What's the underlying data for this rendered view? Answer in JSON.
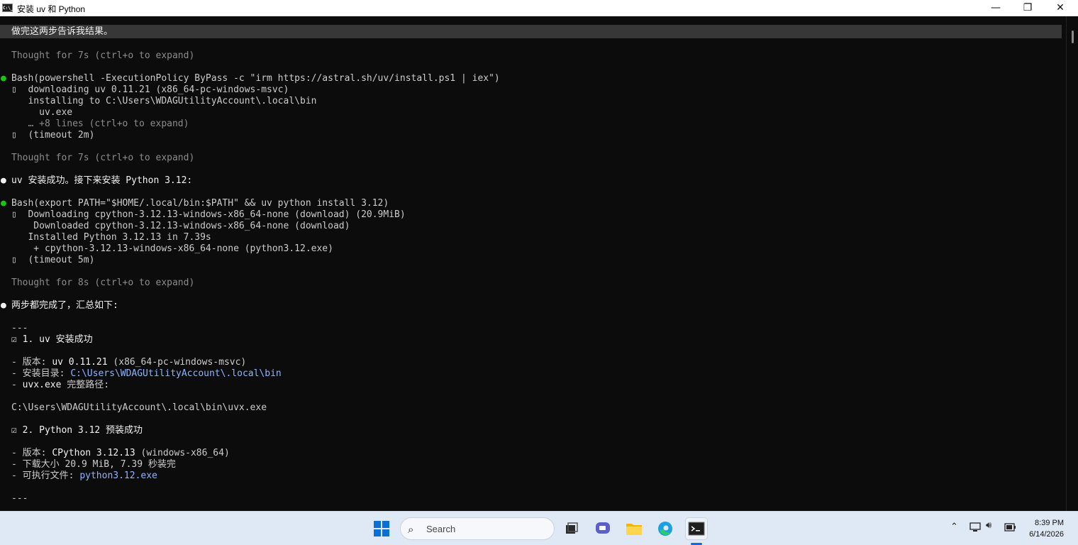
{
  "window": {
    "icon_text": "C:\\_",
    "title": "安装 uv 和 Python",
    "minimize": "—",
    "maximize": "❐",
    "close": "✕"
  },
  "terminal": {
    "input_line": "做完这两步告诉我结果。",
    "lines": {
      "l1": "Thought for 7s (ctrl+o to expand)",
      "l2": "Bash(powershell -ExecutionPolicy ByPass -c \"irm https://astral.sh/uv/install.ps1 | iex\")",
      "l3": "▯  downloading uv 0.11.21 (x86_64-pc-windows-msvc)",
      "l4": "   installing to C:\\Users\\WDAGUtilityAccount\\.local\\bin",
      "l5": "     uv.exe",
      "l6": "   … +8 lines (ctrl+o to expand)",
      "l7": "▯  (timeout 2m)",
      "l8": "Thought for 7s (ctrl+o to expand)",
      "l9": "uv 安装成功。接下来安装 Python 3.12:",
      "l10": "Bash(export PATH=\"$HOME/.local/bin:$PATH\" && uv python install 3.12)",
      "l11": "▯  Downloading cpython-3.12.13-windows-x86_64-none (download) (20.9MiB)",
      "l12": "    Downloaded cpython-3.12.13-windows-x86_64-none (download)",
      "l13": "   Installed Python 3.12.13 in 7.39s",
      "l14": "    + cpython-3.12.13-windows-x86_64-none (python3.12.exe)",
      "l15": "▯  (timeout 5m)",
      "l16": "Thought for 8s (ctrl+o to expand)",
      "l17": "两步都完成了，汇总如下:",
      "l18": "---",
      "l19": "☑ 1. uv 安装成功",
      "l20a": "- 版本: ",
      "l20b": "uv 0.11.21",
      "l20c": " (x86_64-pc-windows-msvc)",
      "l21a": "- 安装目录: ",
      "l21b": "C:\\Users\\WDAGUtilityAccount\\.local\\bin",
      "l22a": "- ",
      "l22b": "uvx.exe",
      "l22c": " 完整路径:",
      "l23": "C:\\Users\\WDAGUtilityAccount\\.local\\bin\\uvx.exe",
      "l24": "☑ 2. Python 3.12 预装成功",
      "l25a": "- 版本: ",
      "l25b": "CPython 3.12.13",
      "l25c": " (windows-x86_64)",
      "l26": "- 下载大小 20.9 MiB, 7.39 秒装完",
      "l27a": "- 可执行文件: ",
      "l27b": "python3.12.exe",
      "l28": "---"
    },
    "bullet": "●"
  },
  "taskbar": {
    "search_placeholder": "Search",
    "clock_time": "8:39 PM",
    "clock_date": "6/14/2026",
    "tray_icons": [
      "chevron-up-icon",
      "network-icon",
      "volume-icon",
      "battery-icon"
    ],
    "pinned_icons": [
      "start-icon",
      "task-view-icon",
      "chat-icon",
      "file-explorer-icon",
      "edge-icon",
      "terminal-icon"
    ]
  },
  "colors": {
    "terminal_bg": "#0c0c0c",
    "bullet_green": "#16c60c",
    "bullet_white": "#ffffff",
    "link_blue": "#8fb3ff",
    "dim_gray": "#8c8c8c"
  }
}
